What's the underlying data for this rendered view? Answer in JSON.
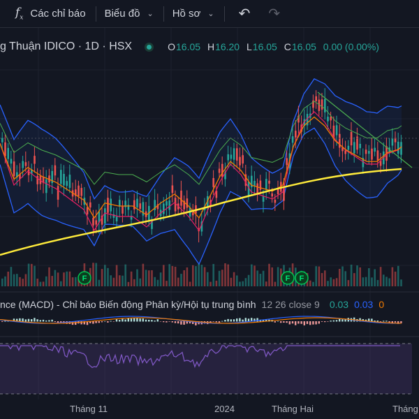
{
  "toolbar": {
    "indicators_label": "Các chỉ báo",
    "chart_type_label": "Biểu đồ",
    "profile_label": "Hồ sơ"
  },
  "legend": {
    "title": "g Thuận IDICO · 1D · HSX",
    "open_key": "O",
    "open": "16.05",
    "high_key": "H",
    "high": "16.20",
    "low_key": "L",
    "low": "16.05",
    "close_key": "C",
    "close": "16.05",
    "change": "0.00 (0.00%)"
  },
  "macd": {
    "name": "nce (MACD) - Chỉ báo Biến động Phân kỳ/Hội tụ trung bình",
    "params": "12 26 close 9",
    "val1": "0.03",
    "val2": "0.03",
    "val3": "0"
  },
  "markers": [
    "F",
    "F",
    "F"
  ],
  "time_axis": [
    "Tháng 11",
    "2024",
    "Tháng Hai",
    "Tháng"
  ],
  "colors": {
    "background": "#131722",
    "up": "#26a69a",
    "down": "#ef5350",
    "bollinger": "#2962ff",
    "ma_long": "#ffeb3b",
    "ma_mid": "#f57c00",
    "ma_short": "#e91e63",
    "rsi": "#7e57c2"
  },
  "icons": [
    "fx-icon",
    "chevron-down-icon",
    "undo-icon",
    "redo-icon",
    "live-dot-icon"
  ]
}
